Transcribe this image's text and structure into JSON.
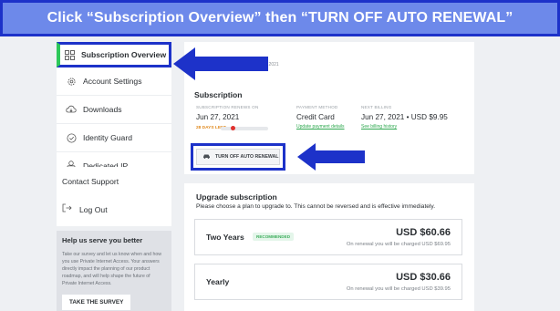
{
  "banner": {
    "text": "Click “Subscription Overview” then “TURN OFF AUTO RENEWAL”"
  },
  "sidebar": {
    "items": [
      {
        "label": "Subscription Overview",
        "icon": "grid-icon",
        "active": true
      },
      {
        "label": "Account Settings",
        "icon": "gear-icon"
      },
      {
        "label": "Downloads",
        "icon": "cloud-download-icon"
      },
      {
        "label": "Identity Guard",
        "icon": "shield-check-icon"
      },
      {
        "label": "Dedicated IP",
        "icon": "server-icon"
      }
    ],
    "support": [
      {
        "label": "Contact Support"
      },
      {
        "label": "Log Out",
        "icon": "logout-icon"
      }
    ]
  },
  "help": {
    "title": "Help us serve you better",
    "body": "Take our survey and let us know when and how you use Private Internet Access. Your answers directly impact the planning of our product roadmap, and will help shape the future of Private Internet Access.",
    "button": "TAKE THE SURVEY"
  },
  "subscription": {
    "stub_date": "9, 2021",
    "title": "Subscription",
    "renews_caption": "SUBSCRIPTION RENEWS ON",
    "renews_value": "Jun 27, 2021",
    "days_left": "28 DAYS LEFT",
    "days_left_fraction": 0.2,
    "payment_caption": "PAYMENT METHOD",
    "payment_value": "Credit Card",
    "payment_link": "Update payment details",
    "billing_caption": "NEXT BILLING",
    "billing_value": "Jun 27, 2021 • USD $9.95",
    "billing_link": "See billing history",
    "turn_off_label": "TURN OFF AUTO RENEWAL"
  },
  "upgrade": {
    "title": "Upgrade subscription",
    "description": "Please choose a plan to upgrade to. This cannot be reversed and is effective immediately.",
    "plans": [
      {
        "name": "Two Years",
        "badge": "RECOMMENDED",
        "price": "USD $60.66",
        "note": "On renewal you will be charged USD $69.95"
      },
      {
        "name": "Yearly",
        "badge": "",
        "price": "USD $30.66",
        "note": "On renewal you will be charged USD $39.95"
      }
    ]
  },
  "colors": {
    "banner_bg": "#6d89ea",
    "highlight_outline": "#1d32c9",
    "active_accent": "#2ec85a",
    "link_green": "#2ea84f"
  }
}
